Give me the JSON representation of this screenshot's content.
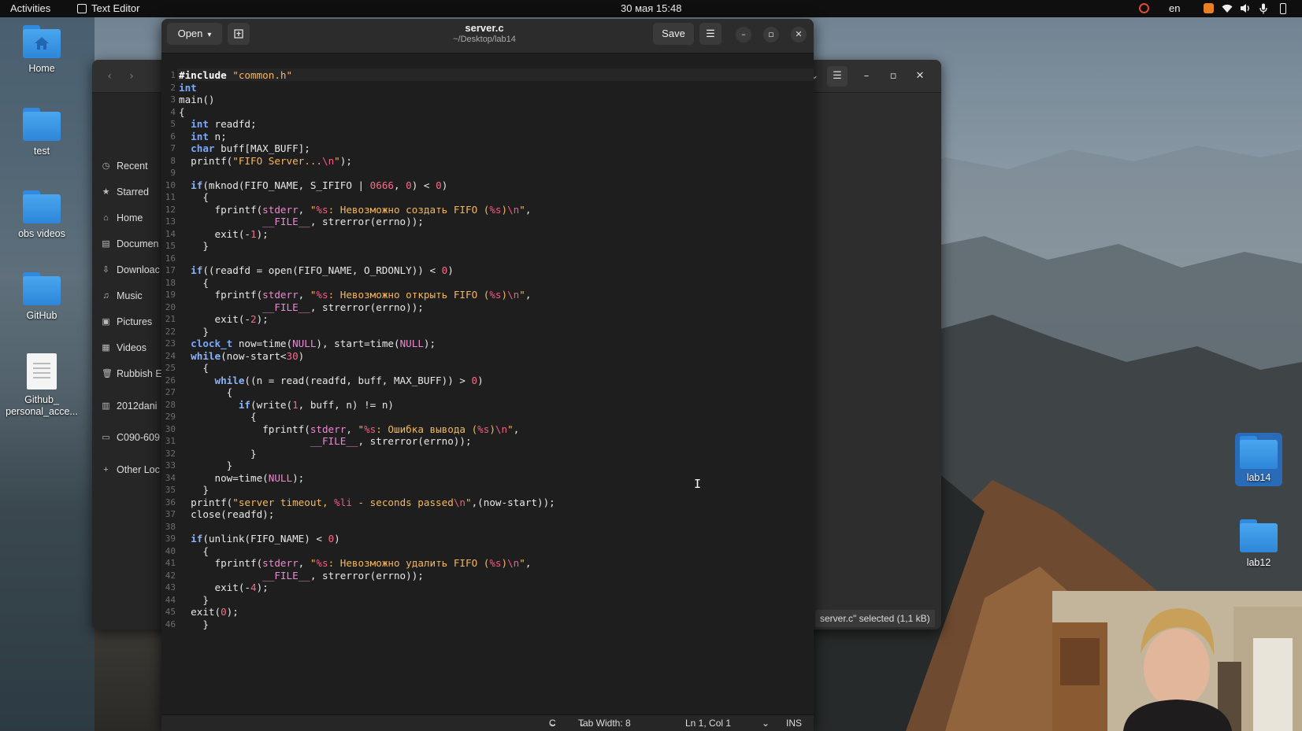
{
  "topbar": {
    "activities": "Activities",
    "app_name": "Text Editor",
    "clock": "30 мая  15:48",
    "lang": "en"
  },
  "desktop": {
    "icons": [
      {
        "label": "Home"
      },
      {
        "label": "test"
      },
      {
        "label": "obs videos"
      },
      {
        "label": "GitHub"
      },
      {
        "label": "Github_ personal_acce..."
      },
      {
        "label": "lab14"
      },
      {
        "label": "lab12"
      }
    ]
  },
  "file_manager": {
    "sidebar": [
      {
        "label": "Recent",
        "icon": "clock-icon"
      },
      {
        "label": "Starred",
        "icon": "star-icon"
      },
      {
        "label": "Home",
        "icon": "home-icon"
      },
      {
        "label": "Documen",
        "icon": "document-icon"
      },
      {
        "label": "Downloac",
        "icon": "download-icon"
      },
      {
        "label": "Music",
        "icon": "music-icon"
      },
      {
        "label": "Pictures",
        "icon": "picture-icon"
      },
      {
        "label": "Videos",
        "icon": "video-icon"
      },
      {
        "label": "Rubbish E",
        "icon": "trash-icon"
      },
      {
        "label": "2012dani",
        "icon": "drive-icon"
      },
      {
        "label": "C090-609",
        "icon": "folder-icon"
      },
      {
        "label": "Other Loc",
        "icon": "plus-icon"
      }
    ],
    "status": "server.c\" selected  (1,1 kB)"
  },
  "editor": {
    "open_label": "Open",
    "save_label": "Save",
    "title": "server.c",
    "subtitle": "~/Desktop/lab14",
    "status": {
      "language": "C",
      "tab_width": "Tab Width: 8",
      "position": "Ln 1, Col 1",
      "mode": "INS"
    },
    "lines": [
      "#include \"common.h\"",
      "int",
      "main()",
      "{",
      "  int readfd;",
      "  int n;",
      "  char buff[MAX_BUFF];",
      "  printf(\"FIFO Server...\\n\");",
      "",
      "  if(mknod(FIFO_NAME, S_IFIFO | 0666, 0) < 0)",
      "    {",
      "      fprintf(stderr, \"%s: Невозможно создать FIFO (%s)\\n\",",
      "              __FILE__, strerror(errno));",
      "      exit(-1);",
      "    }",
      "",
      "  if((readfd = open(FIFO_NAME, O_RDONLY)) < 0)",
      "    {",
      "      fprintf(stderr, \"%s: Невозможно открыть FIFO (%s)\\n\",",
      "              __FILE__, strerror(errno));",
      "      exit(-2);",
      "    }",
      "  clock_t now=time(NULL), start=time(NULL);",
      "  while(now-start<30)",
      "    {",
      "      while((n = read(readfd, buff, MAX_BUFF)) > 0)",
      "        {",
      "          if(write(1, buff, n) != n)",
      "            {",
      "              fprintf(stderr, \"%s: Ошибка вывода (%s)\\n\",",
      "                      __FILE__, strerror(errno));",
      "            }",
      "        }",
      "      now=time(NULL);",
      "    }",
      "  printf(\"server timeout, %li - seconds passed\\n\",(now-start));",
      "  close(readfd);",
      "",
      "  if(unlink(FIFO_NAME) < 0)",
      "    {",
      "      fprintf(stderr, \"%s: Невозможно удалить FIFO (%s)\\n\",",
      "              __FILE__, strerror(errno));",
      "      exit(-4);",
      "    }",
      "  exit(0);",
      "    }"
    ]
  }
}
